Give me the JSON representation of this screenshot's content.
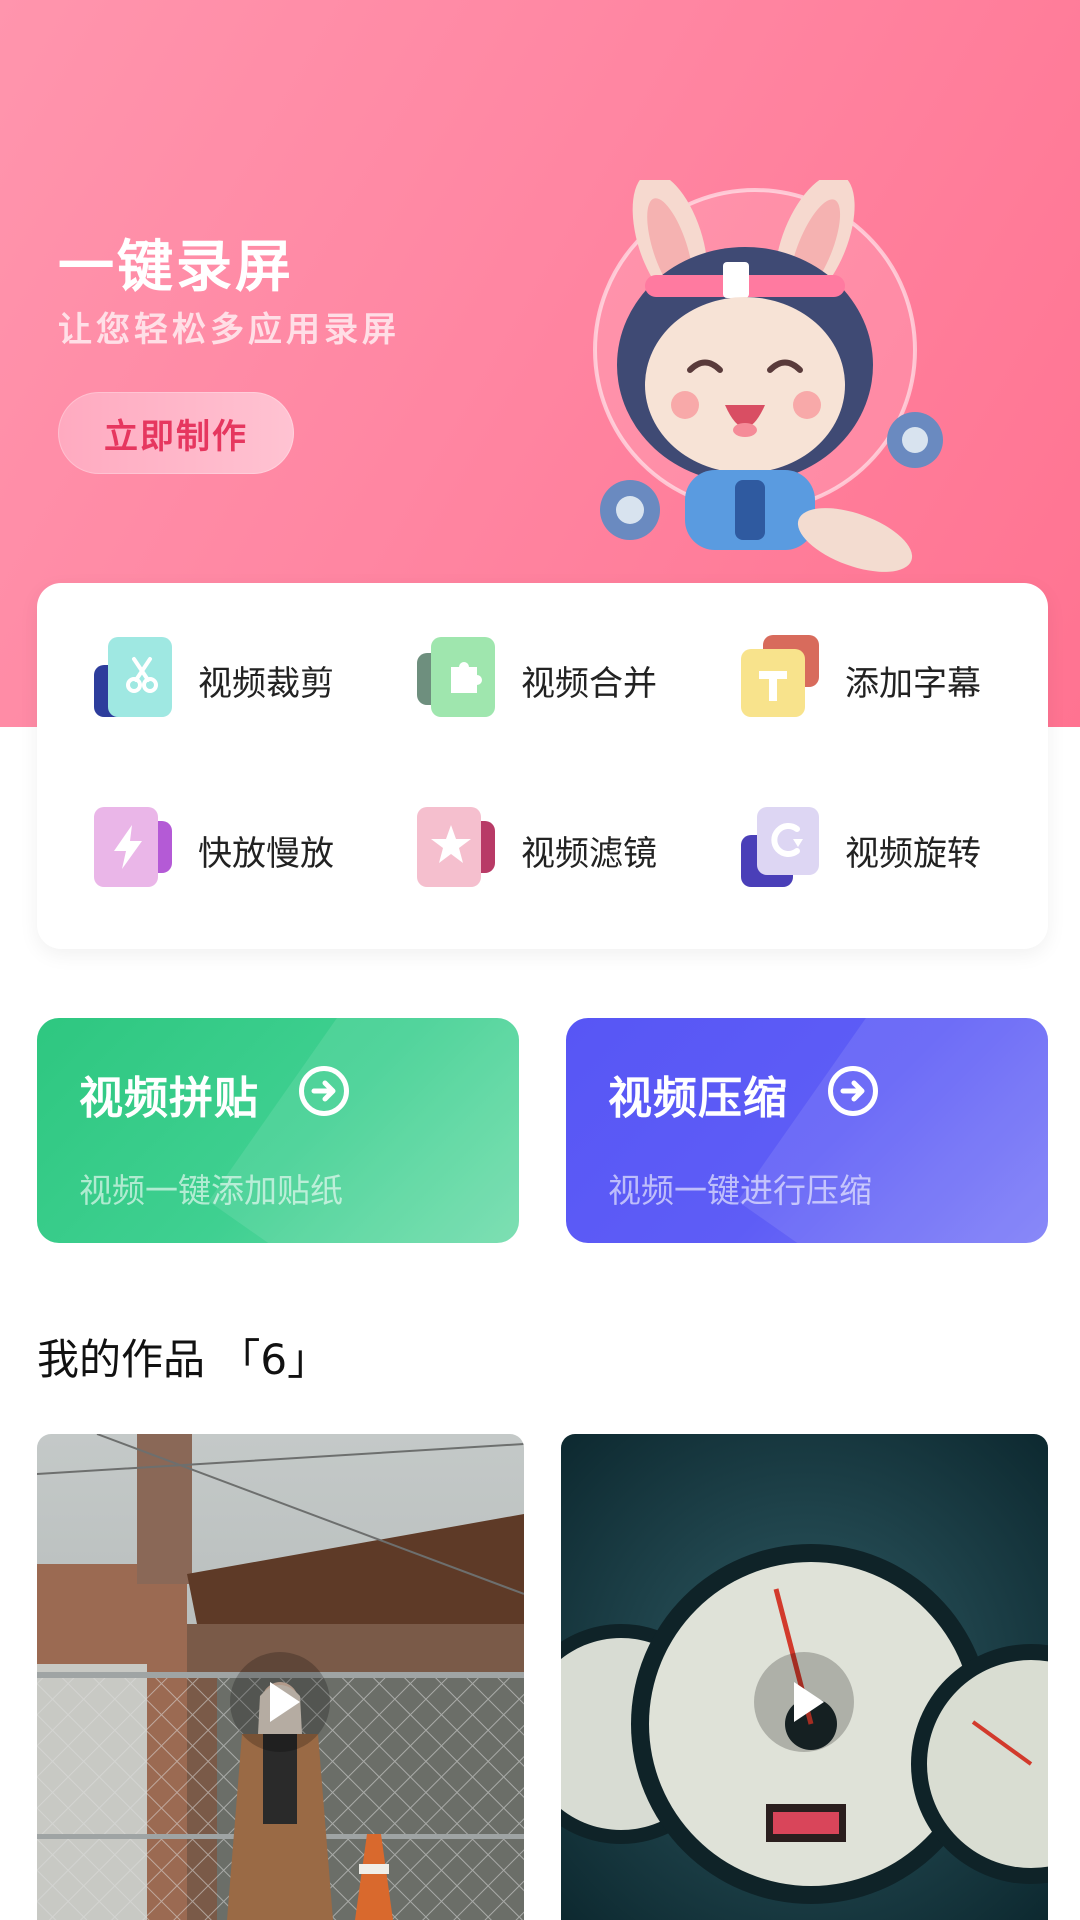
{
  "hero": {
    "title": "一键录屏",
    "subtitle": "让您轻松多应用录屏",
    "button_label": "立即制作"
  },
  "tools": [
    {
      "label": "视频裁剪",
      "icon": "scissors-icon"
    },
    {
      "label": "视频合并",
      "icon": "puzzle-icon"
    },
    {
      "label": "添加字幕",
      "icon": "text-icon"
    },
    {
      "label": "快放慢放",
      "icon": "lightning-icon"
    },
    {
      "label": "视频滤镜",
      "icon": "star-icon"
    },
    {
      "label": "视频旋转",
      "icon": "rotate-icon"
    }
  ],
  "promos": [
    {
      "title": "视频拼贴",
      "subtitle": "视频一键添加贴纸",
      "icon": "arrow-right-circle-icon",
      "color": "#2ec780"
    },
    {
      "title": "视频压缩",
      "subtitle": "视频一键进行压缩",
      "icon": "arrow-right-circle-icon",
      "color": "#5756f5"
    }
  ],
  "works": {
    "title": "我的作品 「6」",
    "items": [
      {
        "thumbnail": "woman-by-fence-photo",
        "icon": "play-icon"
      },
      {
        "thumbnail": "car-speedometer-photo",
        "icon": "play-icon"
      }
    ]
  },
  "colors": {
    "hero_pink": "#ff86a2",
    "button_text": "#e6375f",
    "promo_green": "#2ec780",
    "promo_blue": "#5756f5"
  }
}
